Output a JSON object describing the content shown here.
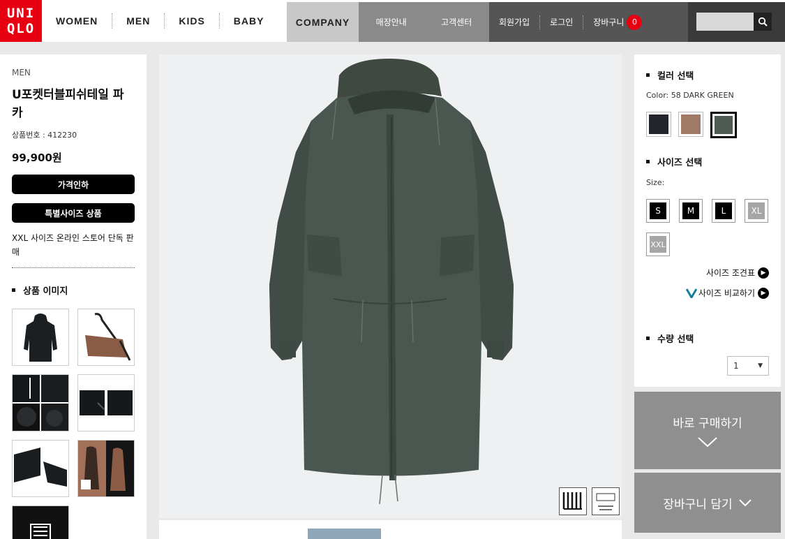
{
  "brand": {
    "logo_line1": "UNI",
    "logo_line2": "QLO"
  },
  "nav": {
    "gender": [
      "WOMEN",
      "MEN",
      "KIDS",
      "BABY"
    ],
    "company": "COMPANY",
    "info": [
      "매장안내",
      "고객센터"
    ],
    "member": [
      "회원가입",
      "로그인"
    ],
    "cart_label": "장바구니",
    "cart_count": "0"
  },
  "product": {
    "category": "MEN",
    "name": "U포켓터블피쉬테일 파카",
    "number_label": "상품번호 : 412230",
    "price": "99,900원",
    "badge_discount": "가격인하",
    "badge_special": "특별사이즈 상품",
    "xxl_note": "XXL 사이즈 온라인 스토어 단독 판매",
    "images_title": "상품 이미지"
  },
  "options": {
    "color_title": "컬러 선택",
    "color_selected": "Color: 58 DARK GREEN",
    "colors": [
      {
        "name": "navy",
        "hex": "#22252c"
      },
      {
        "name": "brown",
        "hex": "#a07a66"
      },
      {
        "name": "dark-green",
        "hex": "#4f5a52"
      }
    ],
    "size_title": "사이즈 선택",
    "size_label": "Size:",
    "sizes": [
      {
        "label": "S",
        "available": true
      },
      {
        "label": "M",
        "available": true
      },
      {
        "label": "L",
        "available": true
      },
      {
        "label": "XL",
        "available": false
      },
      {
        "label": "XXL",
        "available": false
      }
    ],
    "size_chart_link": "사이즈 조견표",
    "size_compare_link": "사이즈 비교하기",
    "qty_title": "수량 선택",
    "qty_value": "1"
  },
  "actions": {
    "buy_now": "바로 구매하기",
    "add_cart": "장바구니 담기"
  }
}
